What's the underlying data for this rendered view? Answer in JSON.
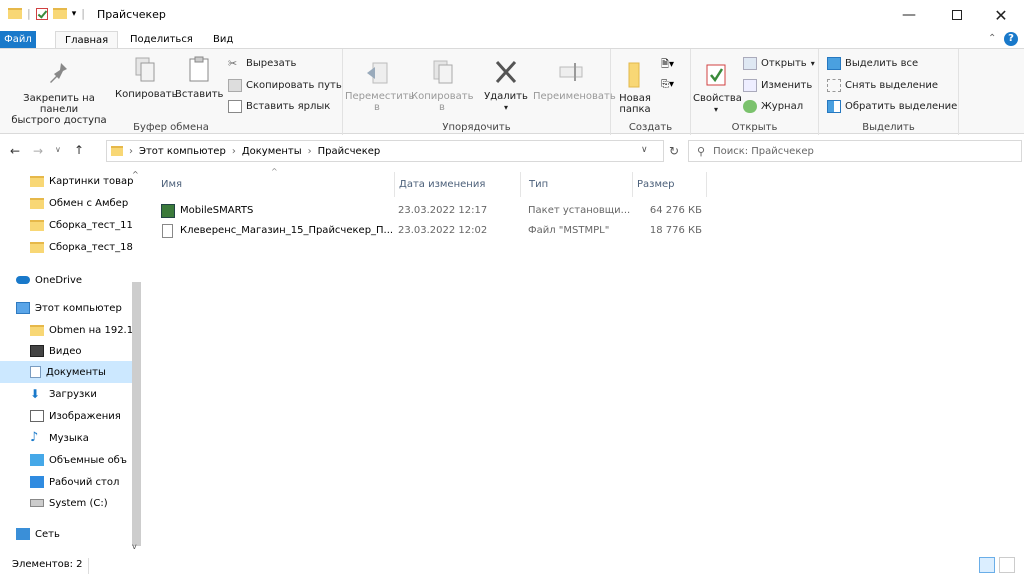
{
  "window": {
    "title": "Прайсчекер"
  },
  "ribbon_tabs": [
    "Файл",
    "Главная",
    "Поделиться",
    "Вид"
  ],
  "clipboard": {
    "pin_label_1": "Закрепить на панели",
    "pin_label_2": "быстрого доступа",
    "copy": "Копировать",
    "paste": "Вставить",
    "cut": "Вырезать",
    "copy_path": "Скопировать путь",
    "paste_shortcut": "Вставить ярлык",
    "group": "Буфер обмена"
  },
  "organize": {
    "move_1": "Переместить",
    "move_2": "в",
    "copy_1": "Копировать",
    "copy_2": "в",
    "delete": "Удалить",
    "rename": "Переименовать",
    "group": "Упорядочить"
  },
  "create": {
    "new_folder_1": "Новая",
    "new_folder_2": "папка",
    "group": "Создать"
  },
  "open": {
    "properties": "Свойства",
    "open": "Открыть",
    "edit": "Изменить",
    "history": "Журнал",
    "group": "Открыть"
  },
  "select": {
    "select_all": "Выделить все",
    "select_none": "Снять выделение",
    "invert": "Обратить выделение",
    "group": "Выделить"
  },
  "address": {
    "path": [
      "Этот компьютер",
      "Документы",
      "Прайсчекер"
    ]
  },
  "search": {
    "placeholder": "Поиск: Прайсчекер"
  },
  "nav": {
    "items": [
      "Картинки товар",
      "Обмен с Амбер",
      "Сборка_тест_11",
      "Сборка_тест_18",
      "OneDrive",
      "Этот компьютер",
      "Obmen на 192.1",
      "Видео",
      "Документы",
      "Загрузки",
      "Изображения",
      "Музыка",
      "Объемные объ",
      "Рабочий стол",
      "System (C:)",
      "Сеть"
    ]
  },
  "columns": {
    "name": "Имя",
    "modified": "Дата изменения",
    "type": "Тип",
    "size": "Размер"
  },
  "files": [
    {
      "name": "MobileSMARTS",
      "modified": "23.03.2022 12:17",
      "type": "Пакет установщи...",
      "size": "64 276 КБ"
    },
    {
      "name": "Клеверенс_Магазин_15_Прайсчекер_П...",
      "modified": "23.03.2022 12:02",
      "type": "Файл \"MSTMPL\"",
      "size": "18 776 КБ"
    }
  ],
  "status": {
    "count": "Элементов: 2"
  },
  "colors": {
    "accent": "#1979ca",
    "selection": "#cce8ff",
    "folder": "#f8d775"
  }
}
